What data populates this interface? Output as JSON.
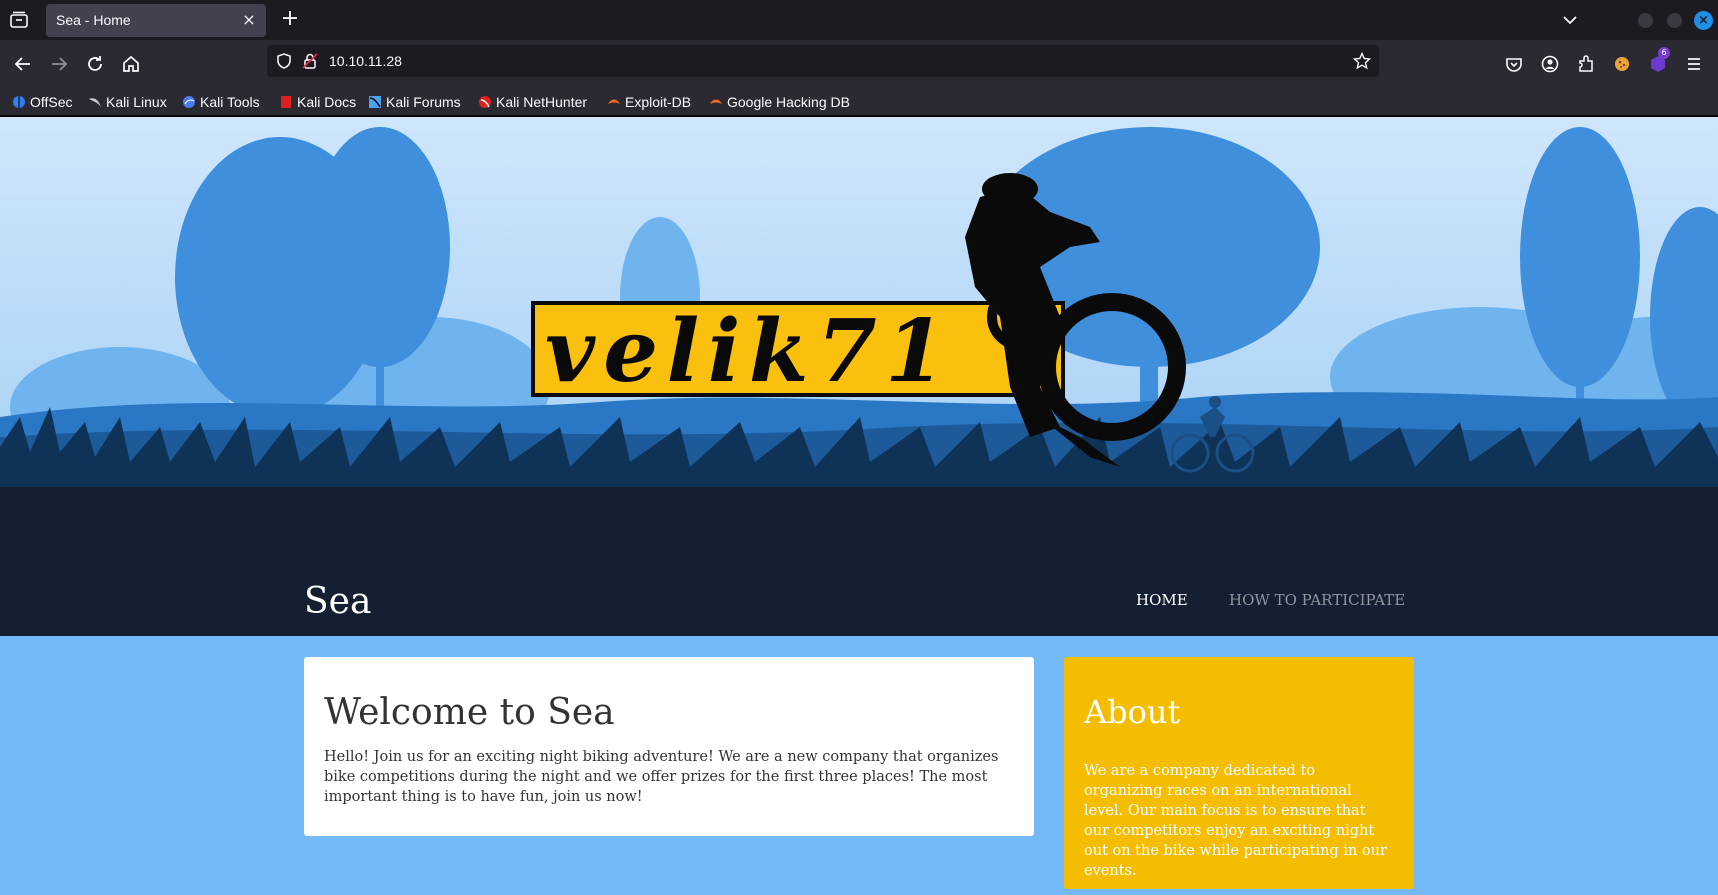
{
  "browser": {
    "tab_title": "Sea - Home",
    "tab_close": "×",
    "new_tab": "+",
    "url": "10.10.11.28",
    "extensions_badge": "6",
    "bookmarks": [
      {
        "label": "OffSec",
        "icon": "offsec-icon",
        "color": "#2f7ff2"
      },
      {
        "label": "Kali Linux",
        "icon": "kali-dragon-icon",
        "color": "#cccccc"
      },
      {
        "label": "Kali Tools",
        "icon": "kali-tools-icon",
        "color": "#4d7cf0"
      },
      {
        "label": "Kali Docs",
        "icon": "kali-docs-icon",
        "color": "#e02020"
      },
      {
        "label": "Kali Forums",
        "icon": "kali-forums-icon",
        "color": "#4da3f0"
      },
      {
        "label": "Kali NetHunter",
        "icon": "nethunter-icon",
        "color": "#e02020"
      },
      {
        "label": "Exploit-DB",
        "icon": "exploit-db-icon",
        "color": "#f06a1c"
      },
      {
        "label": "Google Hacking DB",
        "icon": "ghdb-icon",
        "color": "#f06a1c"
      }
    ]
  },
  "site": {
    "logo_text": "velik71",
    "brand": "Sea",
    "nav": {
      "home": "HOME",
      "participate": "HOW TO PARTICIPATE"
    },
    "welcome": {
      "title": "Welcome to Sea",
      "body": "Hello! Join us for an exciting night biking adventure! We are a new company that organizes bike competitions during the night and we offer prizes for the first three places! The most important thing is to have fun, join us now!"
    },
    "about": {
      "title": "About",
      "body": "We are a company dedicated to organizing races on an international level. Our main focus is to ensure that our competitors enjoy an exciting night out on the bike while participating in our events."
    }
  },
  "colors": {
    "page_bg": "#74b9f8",
    "header_dark": "#142031",
    "about_bg": "#f4bd01",
    "logo_yellow": "#f9c10e"
  }
}
